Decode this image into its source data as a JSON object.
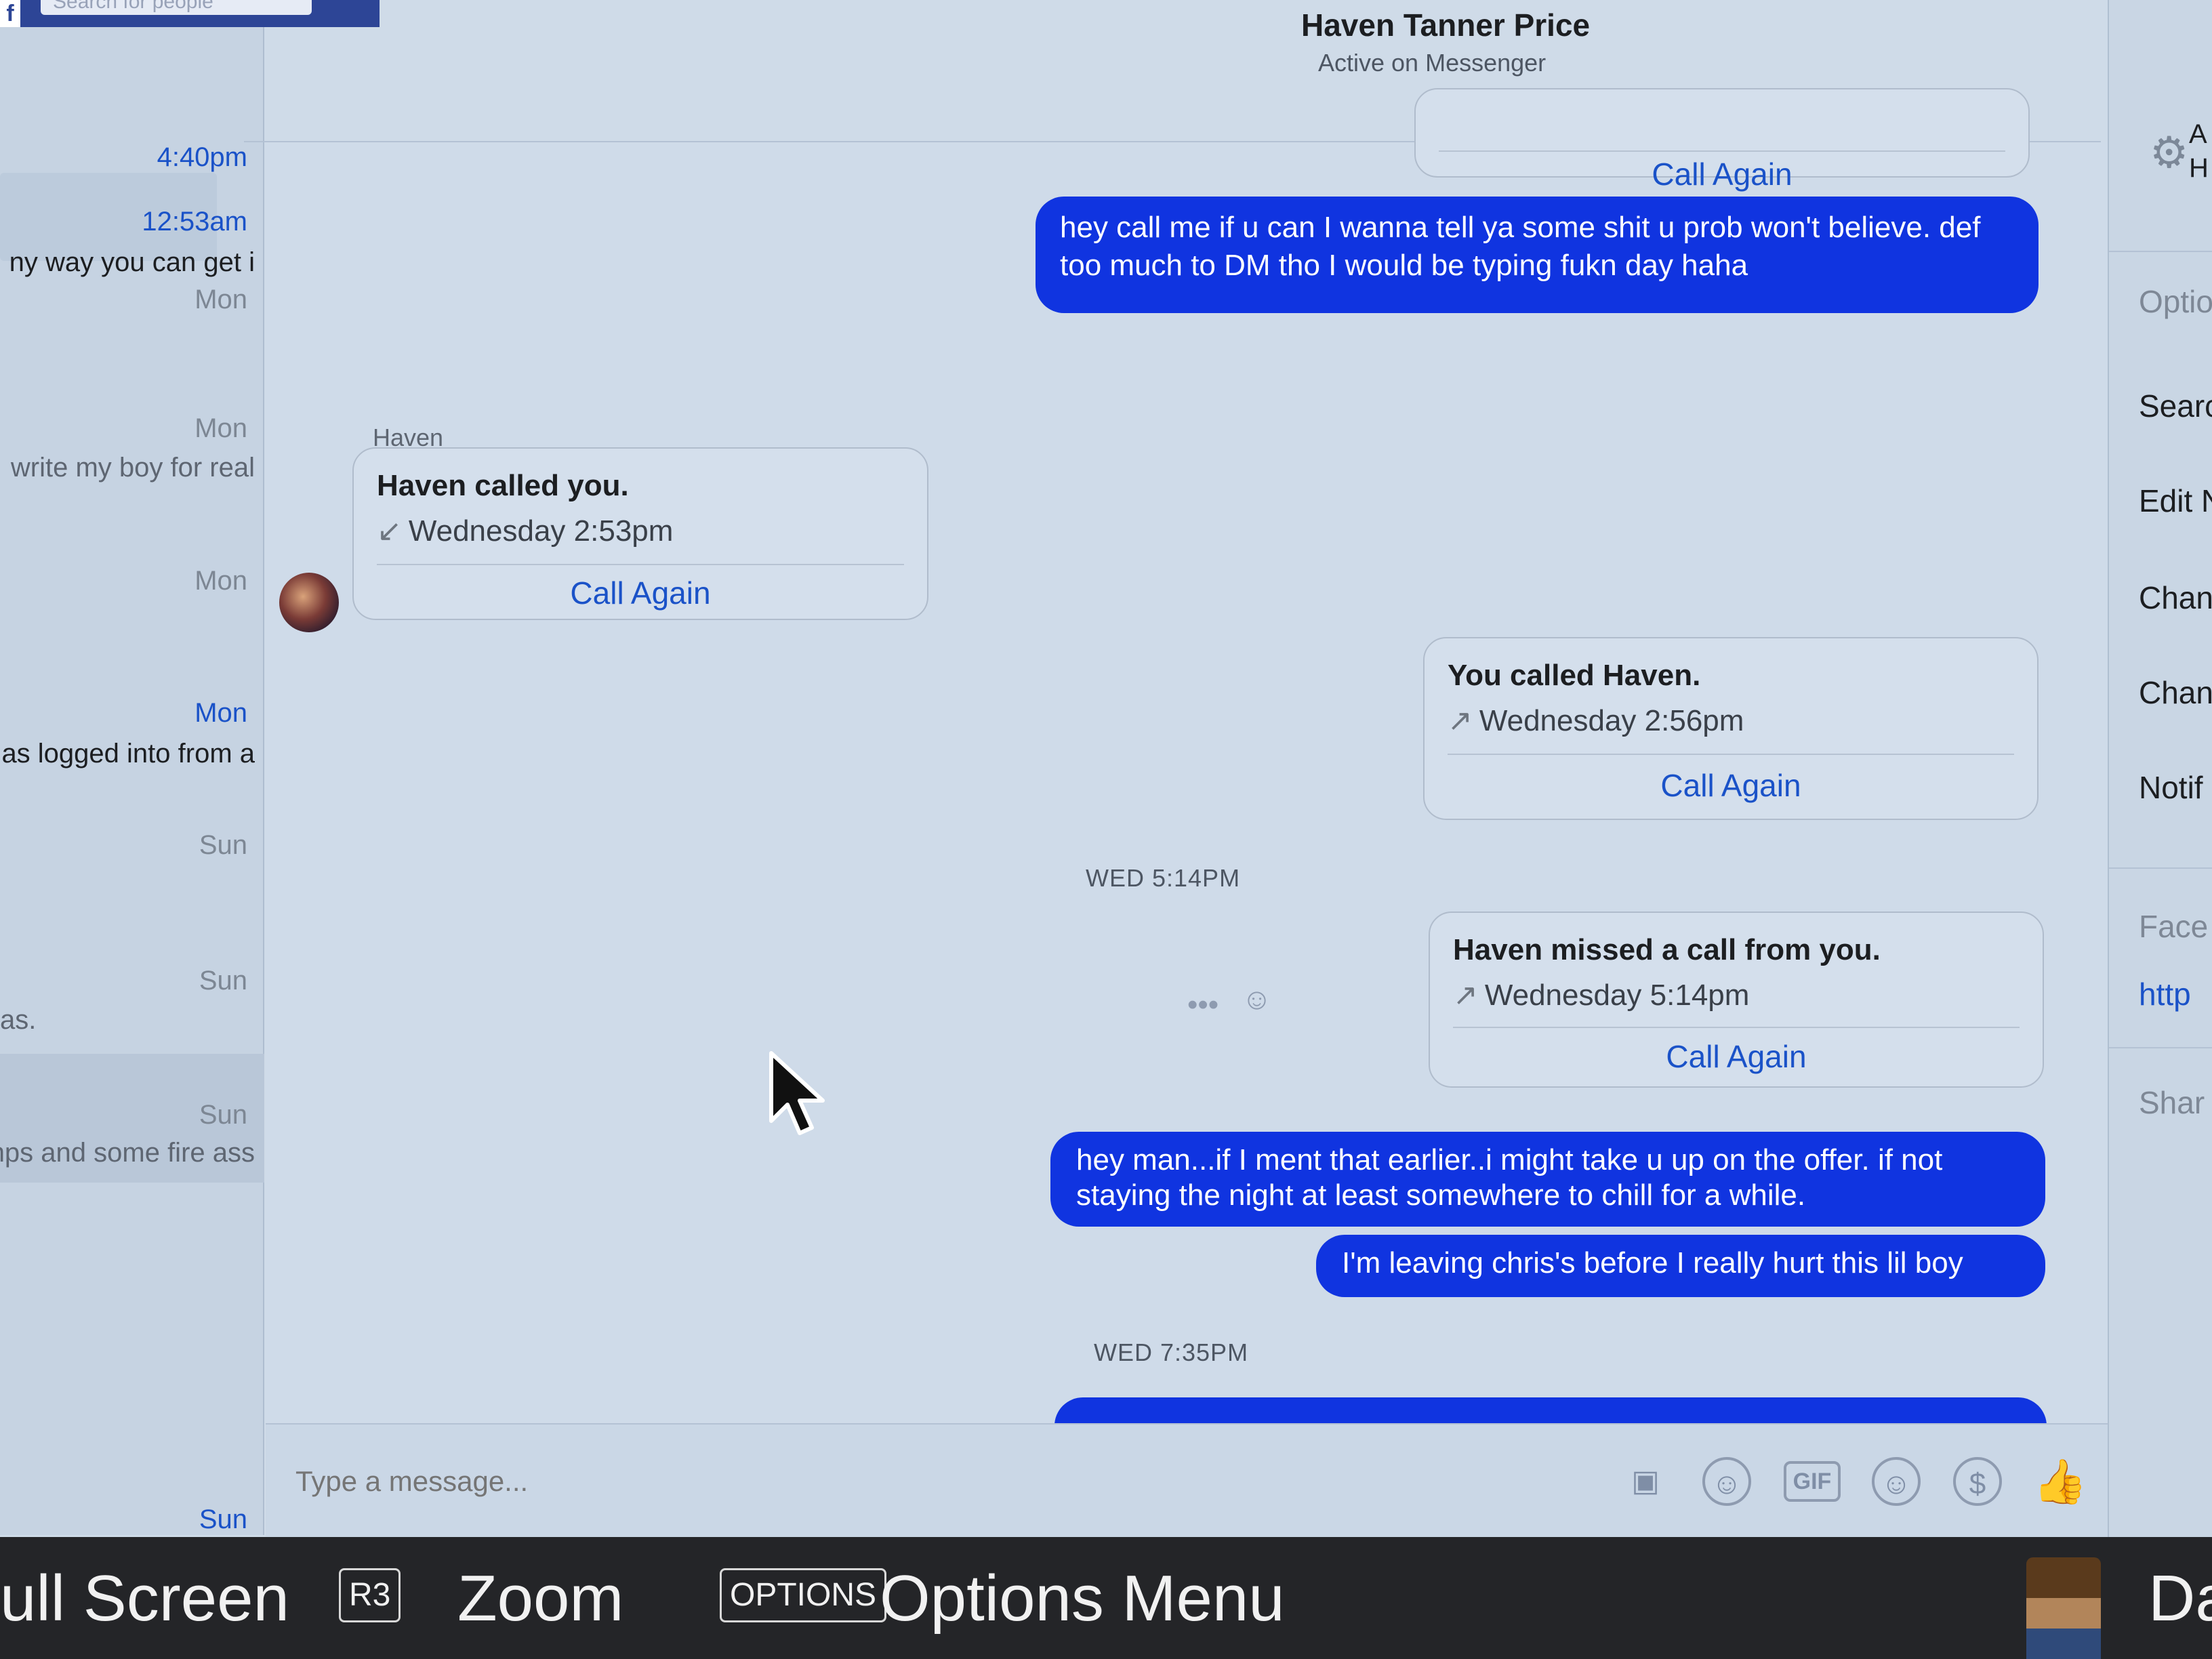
{
  "top": {
    "logo": "f",
    "search_placeholder": "Search for people"
  },
  "header": {
    "name": "Haven Tanner Price",
    "status": "Active on Messenger"
  },
  "conversations": [
    {
      "time": "4:40pm",
      "snippet": "",
      "unread": true
    },
    {
      "time": "12:53am",
      "snippet": "ny way you can get i",
      "unread": true
    },
    {
      "time": "Mon",
      "snippet": "",
      "unread": false
    },
    {
      "time": "Mon",
      "snippet": "write my boy for real",
      "unread": false
    },
    {
      "time": "Mon",
      "snippet": "",
      "unread": false
    },
    {
      "time": "Mon",
      "snippet": "as logged into from a",
      "unread": true
    },
    {
      "time": "Sun",
      "snippet": "",
      "unread": false
    },
    {
      "time": "Sun",
      "snippet": "as.",
      "unread": false
    },
    {
      "time": "Sun",
      "snippet": "nps and some fire ass",
      "unread": false
    },
    {
      "time": "Sun",
      "snippet": "",
      "unread": true
    }
  ],
  "messages": {
    "top_callcard": {
      "call_again": "Call Again"
    },
    "msg1": "hey call me if u can I wanna tell ya some shit u prob won't believe. def too much to DM tho I would be typing fukn day haha",
    "sender_label": "Haven",
    "call1": {
      "title": "Haven called you.",
      "arrow": "↙",
      "when": "Wednesday 2:53pm",
      "call_again": "Call Again"
    },
    "call2": {
      "title": "You called Haven.",
      "arrow": "↗",
      "when": "Wednesday 2:56pm",
      "call_again": "Call Again"
    },
    "stamp1": "WED 5:14PM",
    "call3": {
      "title": "Haven missed a call from you.",
      "arrow": "↗",
      "when": "Wednesday 5:14pm",
      "call_again": "Call Again"
    },
    "msg2": "hey man...if I ment that earlier..i might take u up on the offer. if not staying the night at least somewhere to chill for a while.",
    "msg3": "I'm leaving chris's before I really hurt this lil boy",
    "stamp2": "WED 7:35PM"
  },
  "composer": {
    "placeholder": "Type a message..."
  },
  "right_panel": {
    "top_letters": [
      "A",
      "H"
    ],
    "items": [
      "Optio",
      "Searc",
      "Edit N",
      "Chan",
      "Chan",
      "Notif",
      "Face",
      "http",
      "Shar"
    ]
  },
  "ps_bar": {
    "full_screen": "ull Screen",
    "r3_key": "R3",
    "zoom": "Zoom",
    "options_key": "OPTIONS",
    "options_menu": "Options Menu",
    "right_text": "Da"
  },
  "colors": {
    "accent": "#1a52c8",
    "my_bubble": "#1034e0",
    "brand": "#2d4596"
  }
}
